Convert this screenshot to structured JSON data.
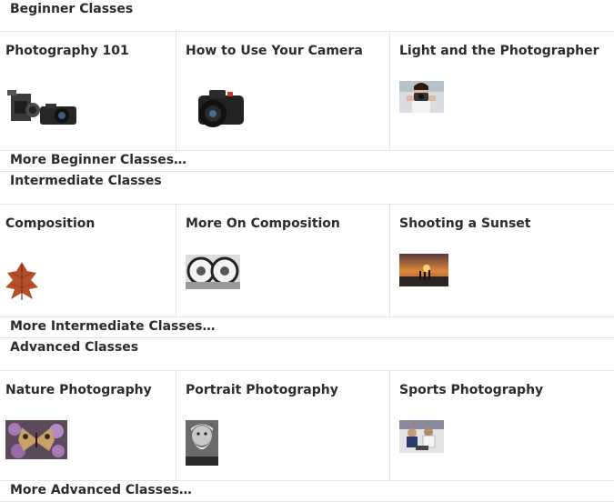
{
  "sections": [
    {
      "title": "Beginner Classes",
      "more_label": "More Beginner Classes…",
      "classes": [
        {
          "title": "Photography 101",
          "image": "vintage-and-modern-cameras"
        },
        {
          "title": "How to Use Your Camera",
          "image": "dslr-camera"
        },
        {
          "title": "Light and the Photographer",
          "image": "photographer-with-camera"
        }
      ]
    },
    {
      "title": "Intermediate Classes",
      "more_label": "More Intermediate Classes…",
      "classes": [
        {
          "title": "Composition",
          "image": "autumn-leaf"
        },
        {
          "title": "More On Composition",
          "image": "faces-through-lenses"
        },
        {
          "title": "Shooting a Sunset",
          "image": "beach-sunset"
        }
      ]
    },
    {
      "title": "Advanced Classes",
      "more_label": "More Advanced Classes…",
      "classes": [
        {
          "title": "Nature Photography",
          "image": "butterfly-on-flowers"
        },
        {
          "title": "Portrait Photography",
          "image": "bearded-man-portrait"
        },
        {
          "title": "Sports Photography",
          "image": "sports-action"
        }
      ]
    }
  ]
}
